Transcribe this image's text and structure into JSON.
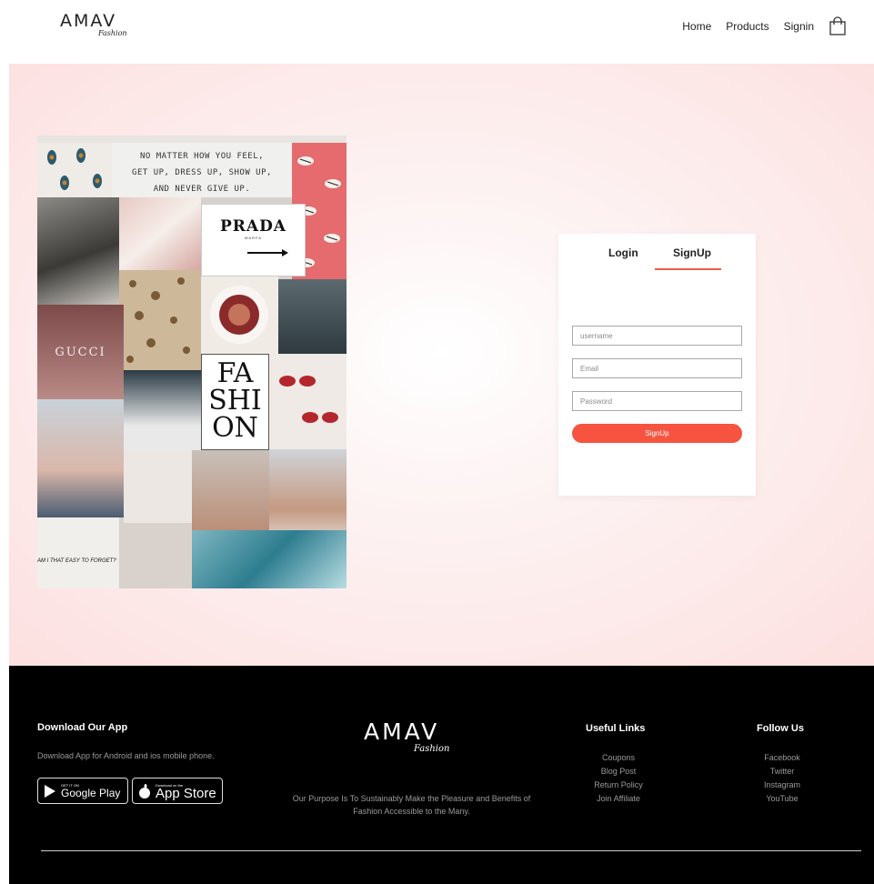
{
  "brand": {
    "name": "AMAV",
    "script": "Fashion"
  },
  "nav": {
    "links": [
      "Home",
      "Products",
      "Signin"
    ],
    "cart_icon": "shopping-bag-icon"
  },
  "collage": {
    "quote": [
      "NO MATTER HOW YOU FEEL,",
      "GET UP, DRESS UP, SHOW UP,",
      "AND NEVER GIVE UP."
    ],
    "prada": "PRADA",
    "marfa": "MARFA",
    "gucci": "GUCCI",
    "fashion": [
      "FA",
      "SHI",
      "ON"
    ],
    "easy": "AM I THAT EASY TO FORGET?"
  },
  "auth": {
    "tabs": [
      "Login",
      "SignUp"
    ],
    "active_tab": "SignUp",
    "fields": {
      "username_placeholder": "username",
      "email_placeholder": "Email",
      "password_placeholder": "Password"
    },
    "submit_label": "SignUp",
    "accent": "#f65440"
  },
  "footer": {
    "app": {
      "title": "Download Our App",
      "text": "Download App for Android and ios mobile phone.",
      "google_small": "GET IT ON",
      "google_big": "Google Play",
      "apple_small": "Download on the",
      "apple_big": "App Store"
    },
    "purpose": "Our Purpose Is To Sustainably Make the Pleasure and Benefits of Fashion Accessible to the Many.",
    "useful": {
      "title": "Useful Links",
      "items": [
        "Coupons",
        "Blog Post",
        "Return Policy",
        "Join Affiliate"
      ]
    },
    "follow": {
      "title": "Follow Us",
      "items": [
        "Facebook",
        "Twitter",
        "Instagram",
        "YouTube"
      ]
    }
  }
}
